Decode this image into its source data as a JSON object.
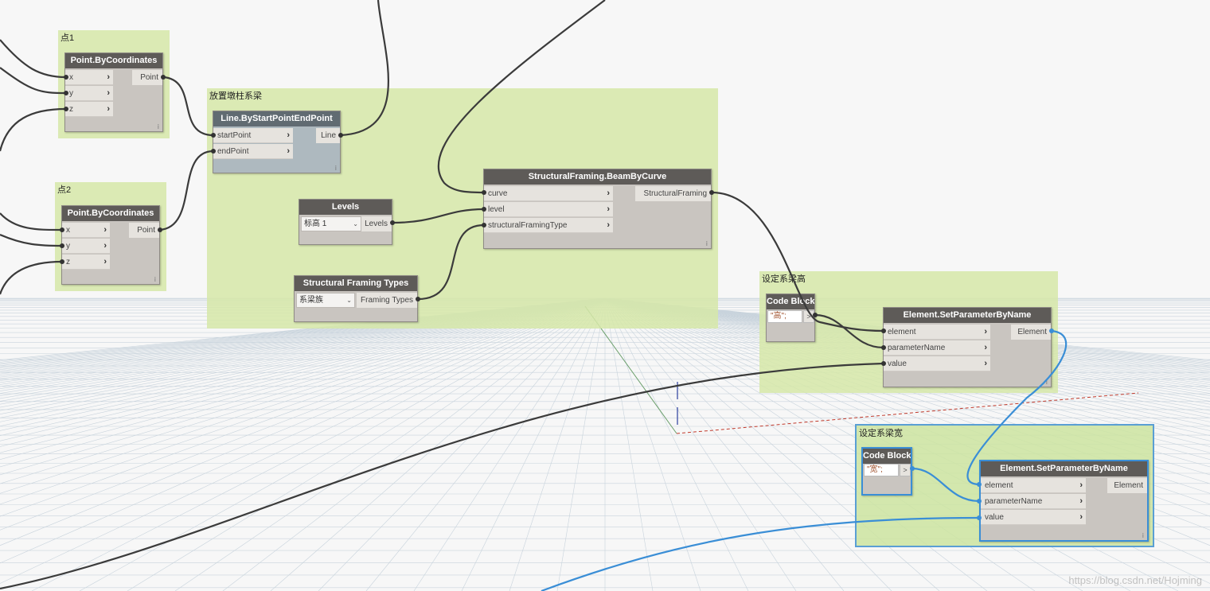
{
  "groups": {
    "point1": {
      "title": "点1"
    },
    "point2": {
      "title": "点2"
    },
    "place_beam": {
      "title": "放置墩柱系梁"
    },
    "set_height": {
      "title": "设定系梁高"
    },
    "set_width": {
      "title": "设定系梁宽"
    }
  },
  "nodes": {
    "point1": {
      "title": "Point.ByCoordinates",
      "inputs": [
        "x",
        "y",
        "z"
      ],
      "output": "Point"
    },
    "point2": {
      "title": "Point.ByCoordinates",
      "inputs": [
        "x",
        "y",
        "z"
      ],
      "output": "Point"
    },
    "line": {
      "title": "Line.ByStartPointEndPoint",
      "inputs": [
        "startPoint",
        "endPoint"
      ],
      "output": "Line"
    },
    "levels": {
      "title": "Levels",
      "selected": "标高 1",
      "output": "Levels"
    },
    "framing_types": {
      "title": "Structural Framing Types",
      "selected": "系梁族",
      "output": "Framing Types"
    },
    "beam": {
      "title": "StructuralFraming.BeamByCurve",
      "inputs": [
        "curve",
        "level",
        "structuralFramingType"
      ],
      "output": "StructuralFraming"
    },
    "code1": {
      "title": "Code Block",
      "code": "\"高\";"
    },
    "setparam1": {
      "title": "Element.SetParameterByName",
      "inputs": [
        "element",
        "parameterName",
        "value"
      ],
      "output": "Element"
    },
    "code2": {
      "title": "Code Block",
      "code": "\"宽\";"
    },
    "setparam2": {
      "title": "Element.SetParameterByName",
      "inputs": [
        "element",
        "parameterName",
        "value"
      ],
      "output": "Element"
    }
  },
  "icons": {
    "port_arrow": "chevron-right-icon",
    "dropdown": "chevron-down-icon"
  },
  "colors": {
    "wire": "#3b3b3b",
    "selected_wire": "#3a8ed6",
    "group": "#d6e8a8",
    "node_header": "#5e5b58"
  },
  "watermark": "https://blog.csdn.net/Hojming"
}
